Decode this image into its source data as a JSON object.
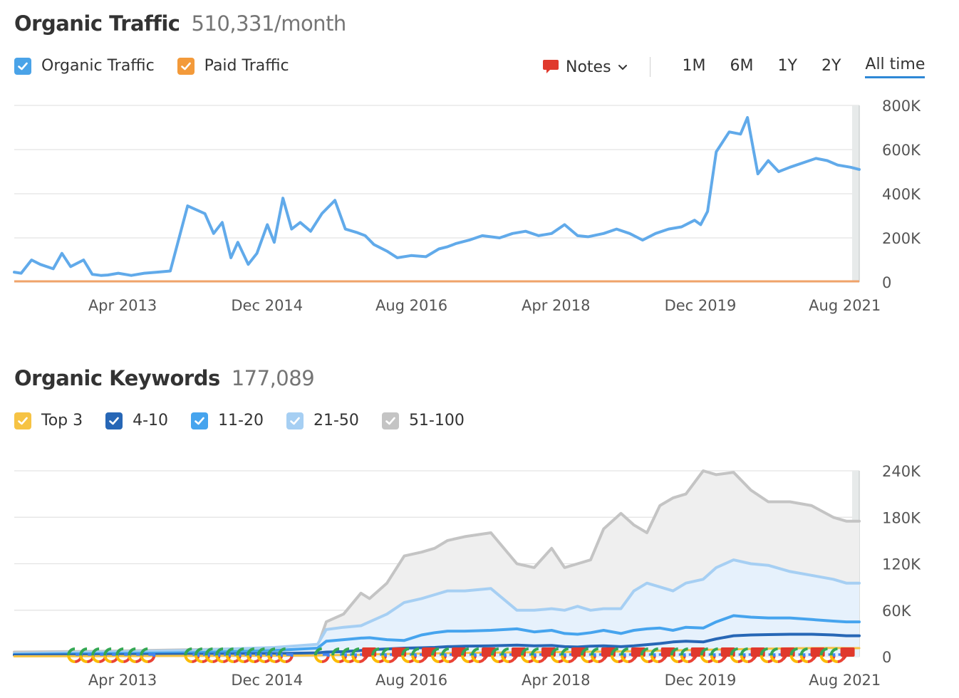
{
  "traffic": {
    "title": "Organic Traffic",
    "subtitle": "510,331/month",
    "legend": [
      {
        "label": "Organic Traffic",
        "color": "#4aa3e8"
      },
      {
        "label": "Paid Traffic",
        "color": "#f39a3a"
      }
    ],
    "notes_label": "Notes",
    "ranges": [
      "1M",
      "6M",
      "1Y",
      "2Y",
      "All time"
    ],
    "active_range": "All time"
  },
  "keywords": {
    "title": "Organic Keywords",
    "subtitle": "177,089",
    "legend": [
      {
        "label": "Top 3",
        "color": "#f6c344"
      },
      {
        "label": "4-10",
        "color": "#2767b6"
      },
      {
        "label": "11-20",
        "color": "#46a4ee"
      },
      {
        "label": "21-50",
        "color": "#a6cff3"
      },
      {
        "label": "51-100",
        "color": "#c4c4c4"
      }
    ]
  },
  "colors": {
    "organic": "#61aaea",
    "paid": "#f0a36a",
    "grid": "#e3e3e3",
    "note_red": "#e0392c",
    "accent": "#2e88d6"
  },
  "chart_data": [
    {
      "type": "line",
      "title": "Organic Traffic",
      "x_ticks": [
        "Apr 2013",
        "Dec 2014",
        "Aug 2016",
        "Apr 2018",
        "Dec 2019",
        "Aug 2021"
      ],
      "y_ticks": [
        "0",
        "200K",
        "400K",
        "600K",
        "800K"
      ],
      "ylim": [
        0,
        800000
      ],
      "xlim": [
        2012.0,
        2021.75
      ],
      "grid": true,
      "series": [
        {
          "name": "Organic Traffic",
          "x": [
            2012.0,
            2012.08,
            2012.2,
            2012.3,
            2012.45,
            2012.55,
            2012.65,
            2012.8,
            2012.9,
            2013.0,
            2013.08,
            2013.2,
            2013.35,
            2013.5,
            2013.65,
            2013.8,
            2014.0,
            2014.2,
            2014.3,
            2014.4,
            2014.5,
            2014.58,
            2014.7,
            2014.8,
            2014.92,
            2015.0,
            2015.1,
            2015.2,
            2015.3,
            2015.42,
            2015.55,
            2015.7,
            2015.82,
            2015.95,
            2016.05,
            2016.15,
            2016.3,
            2016.42,
            2016.58,
            2016.75,
            2016.9,
            2017.0,
            2017.1,
            2017.25,
            2017.4,
            2017.6,
            2017.75,
            2017.9,
            2018.05,
            2018.2,
            2018.35,
            2018.5,
            2018.62,
            2018.8,
            2018.95,
            2019.1,
            2019.25,
            2019.4,
            2019.55,
            2019.7,
            2019.85,
            2019.92,
            2020.0,
            2020.1,
            2020.25,
            2020.38,
            2020.46,
            2020.58,
            2020.7,
            2020.82,
            2020.95,
            2021.1,
            2021.25,
            2021.38,
            2021.5,
            2021.65,
            2021.75
          ],
          "values": [
            45000,
            40000,
            100000,
            80000,
            60000,
            130000,
            70000,
            100000,
            35000,
            30000,
            32000,
            40000,
            30000,
            40000,
            45000,
            50000,
            345000,
            310000,
            220000,
            270000,
            110000,
            180000,
            80000,
            130000,
            260000,
            180000,
            380000,
            240000,
            270000,
            230000,
            310000,
            370000,
            240000,
            225000,
            210000,
            170000,
            140000,
            110000,
            120000,
            115000,
            150000,
            160000,
            175000,
            190000,
            210000,
            200000,
            220000,
            230000,
            210000,
            220000,
            260000,
            210000,
            205000,
            220000,
            240000,
            220000,
            190000,
            220000,
            240000,
            250000,
            280000,
            260000,
            320000,
            590000,
            680000,
            670000,
            745000,
            490000,
            550000,
            500000,
            520000,
            540000,
            560000,
            550000,
            530000,
            520000,
            510000
          ]
        },
        {
          "name": "Paid Traffic",
          "x": [
            2012.0,
            2021.75
          ],
          "values": [
            0,
            0
          ]
        }
      ]
    },
    {
      "type": "area",
      "title": "Organic Keywords",
      "x_ticks": [
        "Apr 2013",
        "Dec 2014",
        "Aug 2016",
        "Apr 2018",
        "Dec 2019",
        "Aug 2021"
      ],
      "y_ticks": [
        "0",
        "60K",
        "120K",
        "180K",
        "240K"
      ],
      "ylim": [
        0,
        240000
      ],
      "xlim": [
        2012.0,
        2021.75
      ],
      "grid": true,
      "x": [
        2012.0,
        2013.0,
        2014.0,
        2015.0,
        2015.5,
        2015.6,
        2015.8,
        2016.0,
        2016.1,
        2016.3,
        2016.5,
        2016.7,
        2016.85,
        2017.0,
        2017.2,
        2017.5,
        2017.8,
        2018.0,
        2018.2,
        2018.35,
        2018.5,
        2018.65,
        2018.8,
        2019.0,
        2019.15,
        2019.3,
        2019.45,
        2019.6,
        2019.75,
        2019.95,
        2020.1,
        2020.3,
        2020.5,
        2020.7,
        2020.95,
        2021.2,
        2021.45,
        2021.6,
        2021.75
      ],
      "series": [
        {
          "name": "Top 3",
          "values": [
            500,
            700,
            1000,
            1300,
            1600,
            2000,
            2200,
            2600,
            3000,
            3400,
            3700,
            4000,
            4300,
            4600,
            5000,
            5300,
            5600,
            5800,
            6000,
            6100,
            6200,
            6400,
            6500,
            6800,
            7000,
            7400,
            7800,
            8000,
            8400,
            8800,
            9200,
            9600,
            10000,
            10400,
            10800,
            11000,
            11200,
            11000,
            11000
          ]
        },
        {
          "name": "4-10",
          "values": [
            2000,
            2500,
            3000,
            4000,
            5000,
            6000,
            6500,
            8000,
            9000,
            10000,
            11000,
            11500,
            12000,
            13000,
            13500,
            14000,
            15000,
            14000,
            14500,
            13000,
            12500,
            13500,
            14000,
            13000,
            14000,
            15500,
            17000,
            19000,
            20000,
            19000,
            23000,
            27000,
            28000,
            28500,
            29000,
            29000,
            28000,
            27000,
            27000
          ]
        },
        {
          "name": "11-20",
          "values": [
            3000,
            4000,
            5000,
            8000,
            11000,
            20000,
            22000,
            24000,
            24500,
            22000,
            21000,
            28000,
            31000,
            33000,
            33000,
            34000,
            36000,
            32000,
            34000,
            30000,
            29000,
            31000,
            34000,
            30000,
            34000,
            36000,
            37000,
            34000,
            38000,
            37000,
            45000,
            53000,
            51000,
            50000,
            50000,
            48000,
            46000,
            45000,
            45000
          ]
        },
        {
          "name": "21-50",
          "values": [
            4000,
            6000,
            8000,
            12000,
            16000,
            35000,
            38000,
            40000,
            45000,
            55000,
            70000,
            75000,
            80000,
            85000,
            85000,
            88000,
            60000,
            60000,
            62000,
            60000,
            65000,
            60000,
            62000,
            62000,
            85000,
            95000,
            90000,
            85000,
            95000,
            100000,
            115000,
            125000,
            120000,
            118000,
            110000,
            105000,
            100000,
            95000,
            95000
          ]
        },
        {
          "name": "51-100",
          "values": [
            6000,
            7000,
            9000,
            11000,
            13000,
            45000,
            55000,
            82000,
            75000,
            95000,
            130000,
            135000,
            140000,
            150000,
            155000,
            160000,
            120000,
            115000,
            140000,
            115000,
            120000,
            125000,
            165000,
            185000,
            170000,
            160000,
            195000,
            205000,
            210000,
            240000,
            235000,
            238000,
            215000,
            200000,
            200000,
            195000,
            180000,
            175000,
            175000
          ]
        }
      ]
    }
  ]
}
